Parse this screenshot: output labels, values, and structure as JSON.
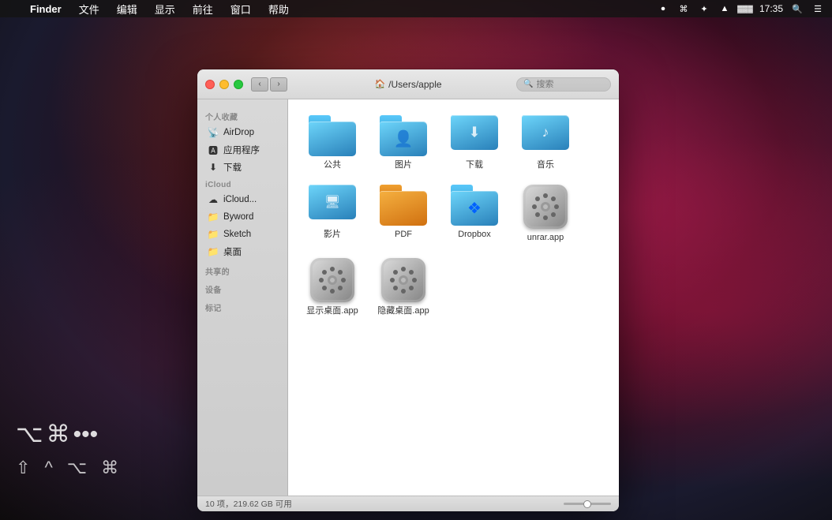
{
  "desktop": {
    "bg_description": "dark explosive powder background"
  },
  "menubar": {
    "apple_symbol": "",
    "items": [
      "Finder",
      "文件",
      "编辑",
      "显示",
      "前往",
      "窗口",
      "帮助"
    ],
    "right_icons": [
      "record",
      "cmd",
      "bluetooth",
      "wifi",
      "battery",
      "time",
      "search",
      "menu"
    ],
    "time": "17:35",
    "battery_level": "75"
  },
  "keyboard_shortcuts": {
    "row1": "⌥ ⌘ •••",
    "row2_items": [
      "⇧",
      "^",
      "⌥",
      "⌘"
    ]
  },
  "finder_window": {
    "title": "/Users/apple",
    "search_placeholder": "搜索",
    "nav_back": "‹",
    "nav_forward": "›",
    "sidebar": {
      "sections": [
        {
          "title": "个人收藏",
          "items": [
            {
              "label": "AirDrop",
              "icon": "airdrop"
            },
            {
              "label": "应用程序",
              "icon": "apps"
            },
            {
              "label": "下载",
              "icon": "download"
            }
          ]
        },
        {
          "title": "iCloud",
          "items": [
            {
              "label": "iCloud...",
              "icon": "cloud"
            },
            {
              "label": "Byword",
              "icon": "folder"
            },
            {
              "label": "Sketch",
              "icon": "folder"
            },
            {
              "label": "桌面",
              "icon": "folder"
            }
          ]
        },
        {
          "title": "共享的",
          "items": []
        },
        {
          "title": "设备",
          "items": []
        },
        {
          "title": "标记",
          "items": []
        }
      ]
    },
    "content": {
      "folders": [
        {
          "label": "公共",
          "icon": "folder",
          "type": "folder"
        },
        {
          "label": "图片",
          "icon": "folder-photos",
          "type": "folder"
        },
        {
          "label": "下载",
          "icon": "folder-download",
          "type": "folder"
        },
        {
          "label": "音乐",
          "icon": "folder-music",
          "type": "folder"
        },
        {
          "label": "影片",
          "icon": "folder-movies",
          "type": "folder"
        },
        {
          "label": "PDF",
          "icon": "folder-plain",
          "type": "folder"
        },
        {
          "label": "Dropbox",
          "icon": "dropbox",
          "type": "folder"
        }
      ],
      "apps": [
        {
          "label": "unrar.app",
          "icon": "gear-app"
        },
        {
          "label": "显示桌面.app",
          "icon": "gear-app"
        },
        {
          "label": "隐藏桌面.app",
          "icon": "gear-app"
        }
      ]
    },
    "statusbar": {
      "text": "10 项，219.62 GB 可用"
    }
  }
}
